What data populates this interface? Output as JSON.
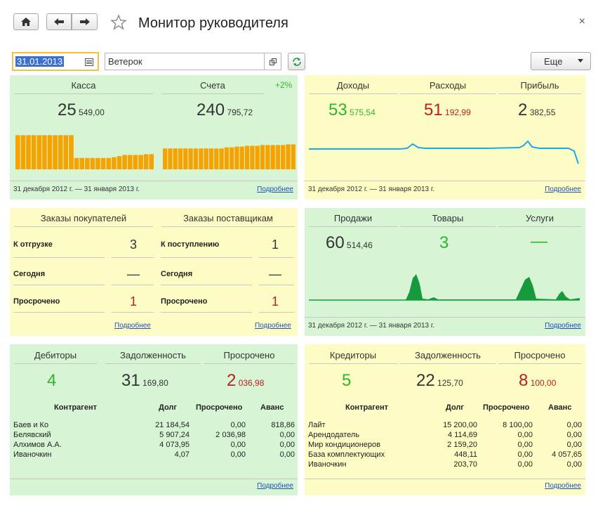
{
  "header": {
    "title": "Монитор руководителя",
    "close": "×"
  },
  "filters": {
    "date": "31.01.2013",
    "org": "Ветерок",
    "more": "Еще"
  },
  "p1": {
    "kassa": "Касса",
    "scheta": "Счета",
    "pct": "+2%",
    "kassa_big": "25",
    "kassa_small": "549,00",
    "scheta_big": "240",
    "scheta_small": "795,72",
    "period": "31 декабря 2012 г. — 31 января 2013 г.",
    "more": "Подробнее"
  },
  "p2": {
    "doh": "Доходы",
    "ras": "Расходы",
    "pri": "Прибыль",
    "doh_big": "53",
    "doh_small": "575,54",
    "ras_big": "51",
    "ras_small": "192,99",
    "pri_big": "2",
    "pri_small": "382,55",
    "period": "31 декабря 2012 г. — 31 января 2013 г.",
    "more": "Подробнее"
  },
  "p3": {
    "zp": "Заказы покупателей",
    "zs": "Заказы поставщикам",
    "r1l": "К отгрузке",
    "r1v": "3",
    "r2l": "Сегодня",
    "r2v": "—",
    "r3l": "Просрочено",
    "r3v": "1",
    "s1l": "К поступлению",
    "s1v": "1",
    "s2l": "Сегодня",
    "s2v": "—",
    "s3l": "Просрочено",
    "s3v": "1",
    "more": "Подробнее",
    "more2": "Подробнее"
  },
  "p4": {
    "prod": "Продажи",
    "tov": "Товары",
    "usl": "Услуги",
    "prod_big": "60",
    "prod_small": "514,46",
    "tov_big": "3",
    "usl_big": "—",
    "period": "31 декабря 2012 г. — 31 января 2013 г.",
    "more": "Подробнее"
  },
  "p5": {
    "deb": "Дебиторы",
    "zad": "Задолженность",
    "pro": "Просрочено",
    "deb_big": "4",
    "zad_big": "31",
    "zad_small": "169,80",
    "pro_big": "2",
    "pro_small": "036,98",
    "cols": [
      "Контрагент",
      "Долг",
      "Просрочено",
      "Аванс"
    ],
    "rows": [
      [
        "Баев и Ко",
        "21 184,54",
        "0,00",
        "818,86"
      ],
      [
        "Белявский",
        "5 907,24",
        "2 036,98",
        "0,00"
      ],
      [
        "Алхимов А.А.",
        "4 073,95",
        "0,00",
        "0,00"
      ],
      [
        "Иваночкин",
        "4,07",
        "0,00",
        "0,00"
      ]
    ],
    "more": "Подробнее"
  },
  "p6": {
    "kre": "Кредиторы",
    "zad": "Задолженность",
    "pro": "Просрочено",
    "kre_big": "5",
    "zad_big": "22",
    "zad_small": "125,70",
    "pro_big": "8",
    "pro_small": "100,00",
    "cols": [
      "Контрагент",
      "Долг",
      "Просрочено",
      "Аванс"
    ],
    "rows": [
      [
        "Лайт",
        "15 200,00",
        "8 100,00",
        "0,00"
      ],
      [
        "Арендодатель",
        "4 114,69",
        "0,00",
        "0,00"
      ],
      [
        "Мир кондиционеров",
        "2 159,20",
        "0,00",
        "0,00"
      ],
      [
        "База комплектующих",
        "448,11",
        "0,00",
        "4 057,65"
      ],
      [
        "Иваночкин",
        "203,70",
        "0,00",
        "0,00"
      ]
    ],
    "more": "Подробнее"
  },
  "charts": {
    "kassa_bars": [
      0.9,
      0.9,
      0.9,
      0.9,
      0.9,
      0.9,
      0.9,
      0.9,
      0.9,
      0.9,
      0.9,
      0.3,
      0.3,
      0.3,
      0.3,
      0.3,
      0.3,
      0.3,
      0.32,
      0.35,
      0.38,
      0.38,
      0.38,
      0.38,
      0.4,
      0.4
    ],
    "scheta_bars": [
      0.55,
      0.55,
      0.55,
      0.55,
      0.55,
      0.55,
      0.55,
      0.55,
      0.55,
      0.55,
      0.55,
      0.55,
      0.58,
      0.58,
      0.6,
      0.6,
      0.62,
      0.62,
      0.62,
      0.64,
      0.64,
      0.64,
      0.64,
      0.64,
      0.66,
      0.66
    ],
    "bar_color": "#f5a300",
    "line_color": "#1ea9ea",
    "area_color": "#169a3c"
  }
}
